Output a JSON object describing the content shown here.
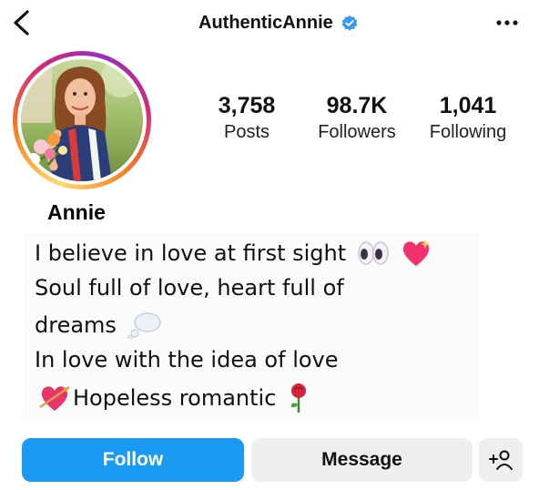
{
  "header": {
    "username": "AuthenticAnnie",
    "back_icon": "chevron-left-icon",
    "verified_icon": "verified-badge-icon",
    "more_icon": "more-horizontal-icon",
    "verified_color": "#3897f0"
  },
  "profile": {
    "name": "Annie",
    "avatar_icon": "profile-photo",
    "ring_colors": [
      "#feda75",
      "#fa7e1e",
      "#d62976",
      "#962fbf"
    ]
  },
  "stats": [
    {
      "value": "3,758",
      "label": "Posts"
    },
    {
      "value": "98.7K",
      "label": "Followers"
    },
    {
      "value": "1,041",
      "label": "Following"
    }
  ],
  "bio": {
    "lines": [
      "I believe in love at first sight",
      "Soul full of love, heart full of",
      "dreams",
      "In love with the idea of love",
      "Hopeless romantic"
    ],
    "emoji_icons": [
      "eyes-icon",
      "sparkling-heart-icon",
      "thought-bubble-icon",
      "heart-arrow-icon",
      "rose-icon"
    ]
  },
  "actions": {
    "follow_label": "Follow",
    "message_label": "Message",
    "suggest_icon": "add-person-icon",
    "follow_color": "#1a9af2",
    "secondary_color": "#efefef"
  }
}
